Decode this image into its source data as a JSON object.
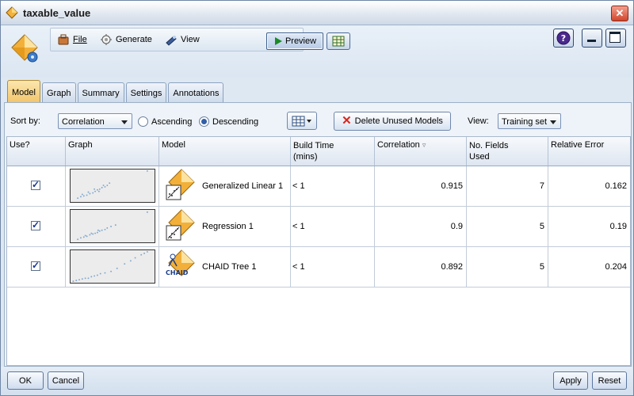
{
  "window": {
    "title": "taxable_value"
  },
  "menu": {
    "file": "File",
    "generate": "Generate",
    "view": "View",
    "preview": "Preview"
  },
  "tabs": [
    {
      "label": "Model",
      "active": true
    },
    {
      "label": "Graph"
    },
    {
      "label": "Summary"
    },
    {
      "label": "Settings"
    },
    {
      "label": "Annotations"
    }
  ],
  "sortbar": {
    "sort_by_label": "Sort by:",
    "sort_by_value": "Correlation",
    "ascending": "Ascending",
    "descending": "Descending",
    "selected_order": "Descending",
    "delete_button": "Delete Unused Models",
    "view_label": "View:",
    "view_value": "Training set"
  },
  "table": {
    "columns": [
      "Use?",
      "Graph",
      "Model",
      "Build Time",
      "(mins)",
      "Correlation",
      "No. Fields",
      "Used",
      "Relative Error"
    ],
    "rows": [
      {
        "use": true,
        "model": "Generalized Linear 1",
        "build_time": "< 1",
        "correlation": "0.915",
        "fields_used": "7",
        "relative_error": "0.162",
        "icon": "generalized-linear-icon"
      },
      {
        "use": true,
        "model": "Regression 1",
        "build_time": "< 1",
        "correlation": "0.9",
        "fields_used": "5",
        "relative_error": "0.19",
        "icon": "regression-icon"
      },
      {
        "use": true,
        "model": "CHAID Tree 1",
        "build_time": "< 1",
        "correlation": "0.892",
        "fields_used": "5",
        "relative_error": "0.204",
        "icon": "chaid-icon"
      }
    ],
    "chaid_label": "CHAID"
  },
  "footer": {
    "ok": "OK",
    "cancel": "Cancel",
    "apply": "Apply",
    "reset": "Reset"
  },
  "colors": {
    "accent": "#f2c46a",
    "close": "#d2452c",
    "selection": "#2f5fa8"
  }
}
